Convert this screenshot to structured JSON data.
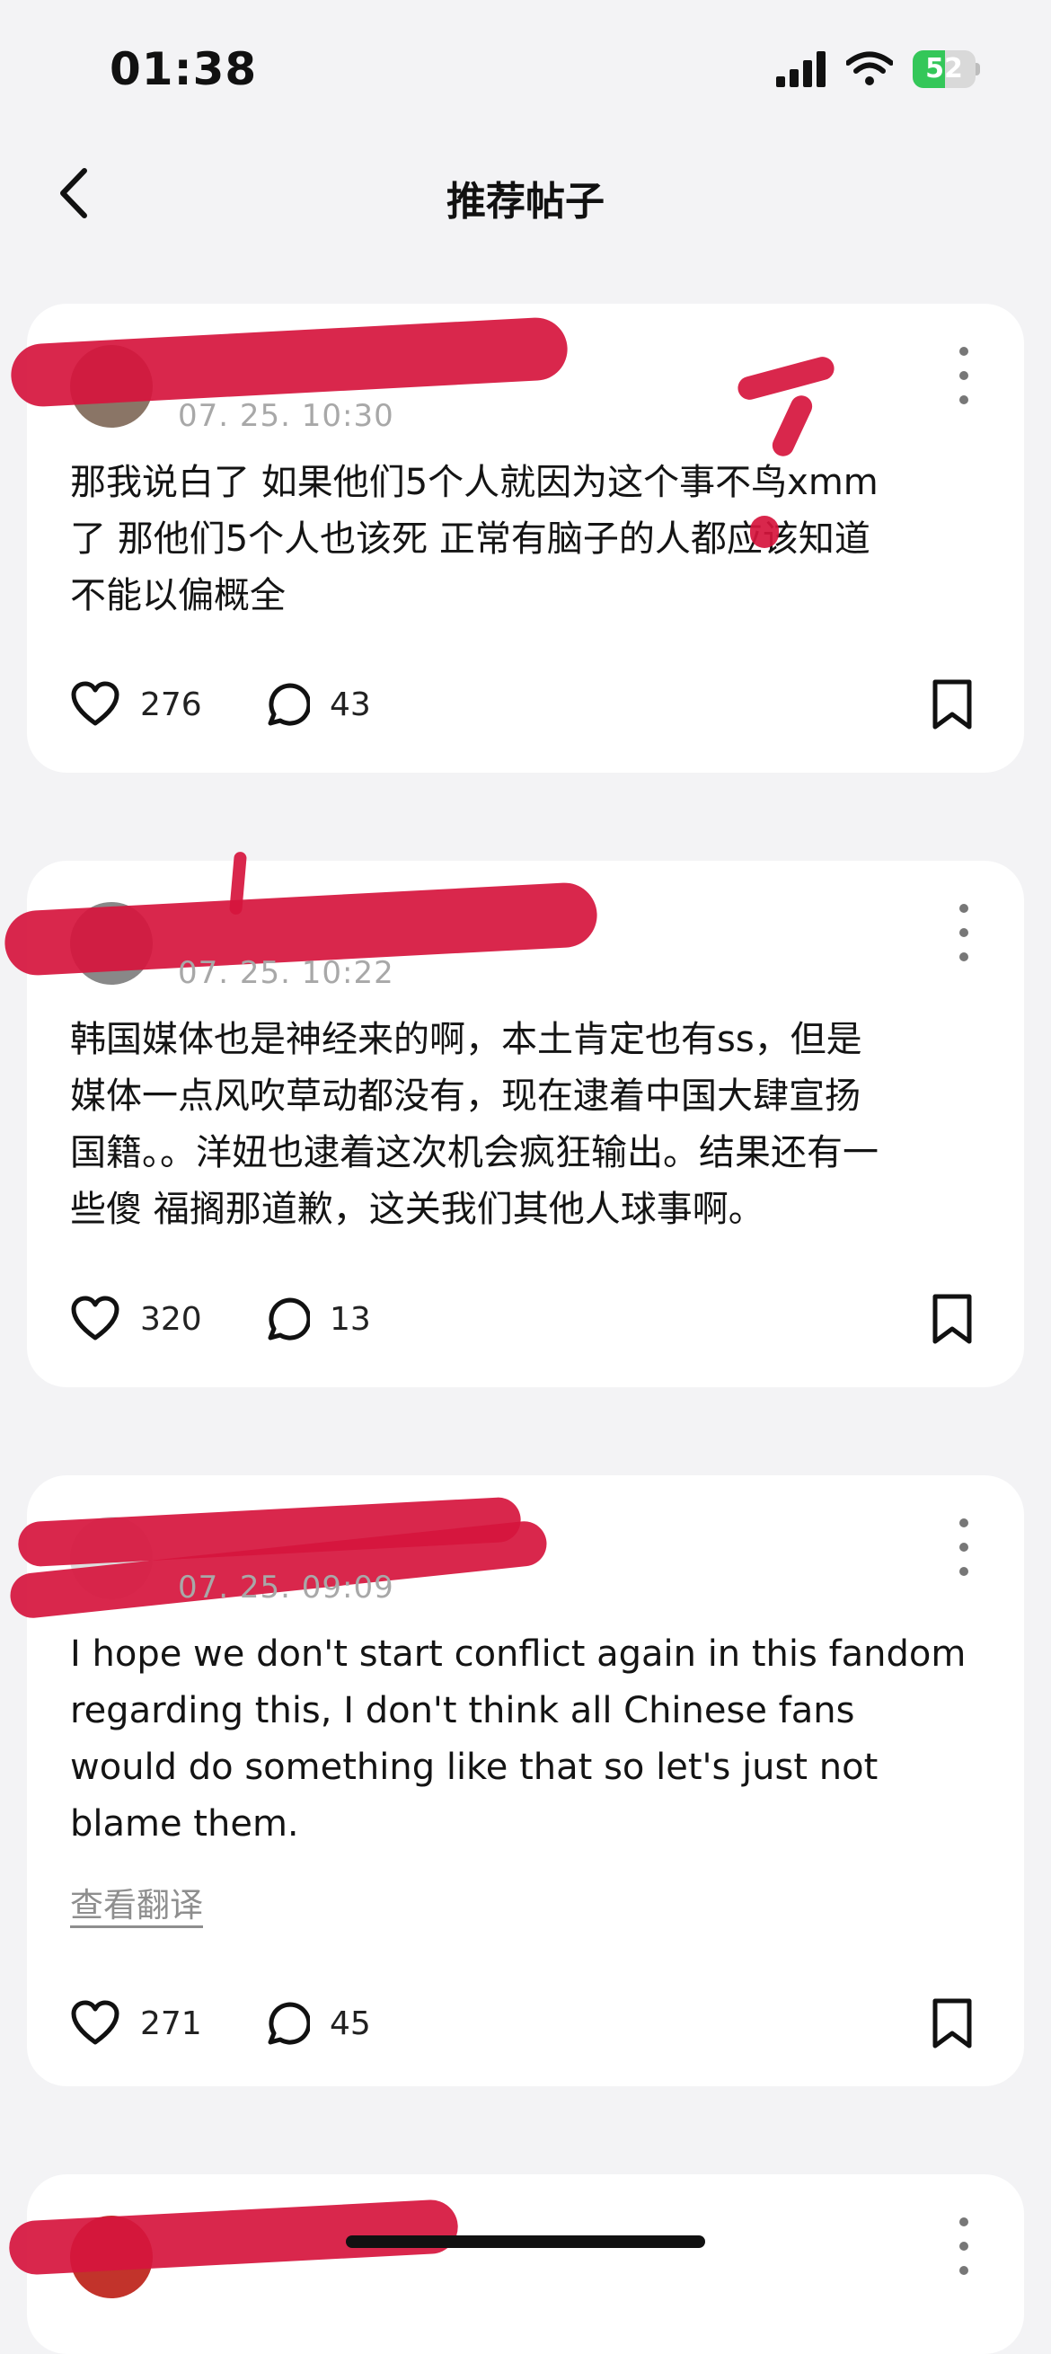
{
  "status_bar": {
    "time": "01:38",
    "battery": "52",
    "battery_level": 0.52
  },
  "nav": {
    "title": "推荐帖子"
  },
  "posts": [
    {
      "timestamp": "07. 25. 10:30",
      "text": "那我说白了 如果他们5个人就因为这个事不鸟xmm\n了 那他们5个人也该死 正常有脑子的人都应该知道\n不能以偏概全",
      "likes": "276",
      "comments": "43"
    },
    {
      "timestamp": "07. 25. 10:22",
      "text": "韩国媒体也是神经来的啊，本土肯定也有ss，但是\n媒体一点风吹草动都没有，现在逮着中国大肆宣扬\n国籍。。洋妞也逮着这次机会疯狂输出。结果还有一\n些傻 福搁那道歉，这关我们其他人球事啊。",
      "likes": "320",
      "comments": "13"
    },
    {
      "timestamp": "07. 25. 09:09",
      "text": "I hope we don't start conflict again in this fandom\nregarding this, I don't think all Chinese fans\nwould do something like that so let's just not\nblame them.",
      "translate_label": "查看翻译",
      "likes": "271",
      "comments": "45"
    }
  ],
  "colors": {
    "redaction": "#d6153d",
    "battery_green": "#34c759",
    "background": "#f3f3f5"
  },
  "icons": [
    "back-chevron-icon",
    "signal-icon",
    "wifi-icon",
    "battery-icon",
    "more-vertical-icon",
    "heart-icon",
    "comment-bubble-icon",
    "bookmark-icon"
  ]
}
